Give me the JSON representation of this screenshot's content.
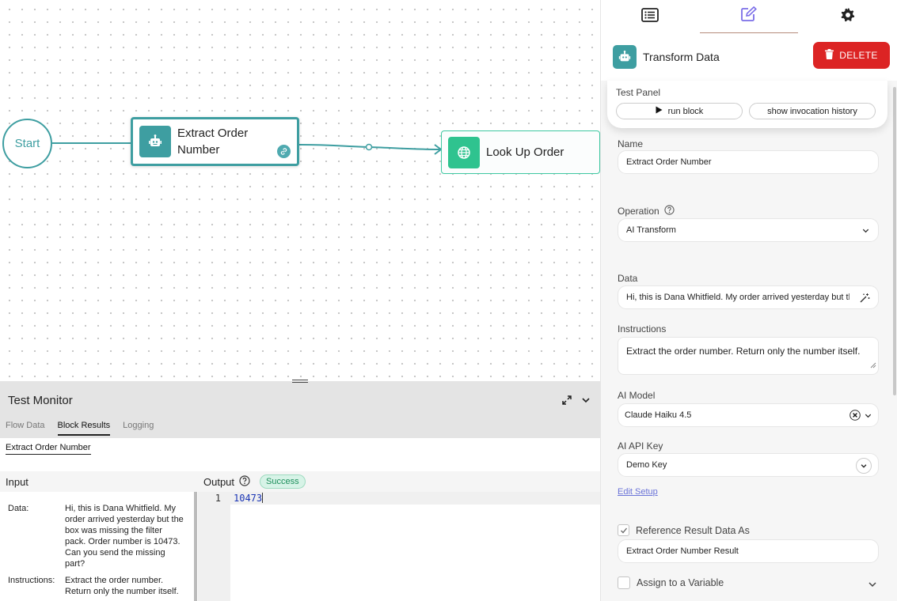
{
  "canvas": {
    "start_label": "Start",
    "nodes": [
      {
        "label": "Extract Order Number",
        "icon": "robot-icon"
      },
      {
        "label": "Look Up Order",
        "icon": "globe-icon"
      }
    ]
  },
  "monitor": {
    "title": "Test Monitor",
    "tabs": [
      "Flow Data",
      "Block Results",
      "Logging"
    ],
    "active_tab": "Block Results",
    "sub_tab": "Extract Order Number",
    "input_header": "Input",
    "output_header": "Output",
    "status": "Success",
    "inputs": [
      {
        "key": "Data:",
        "value": "Hi, this is Dana Whitfield. My order arrived yesterday but the box was missing the filter pack. Order number is 10473. Can you send the missing part?"
      },
      {
        "key": "Instructions:",
        "value": "Extract the order number. Return only the number itself."
      }
    ],
    "output_line_number": "1",
    "output_value": "10473"
  },
  "panel": {
    "title": "Transform Data",
    "delete_label": "DELETE",
    "test_panel": {
      "label": "Test Panel",
      "run_label": "run block",
      "history_label": "show invocation history"
    },
    "name": {
      "label": "Name",
      "value": "Extract Order Number"
    },
    "operation": {
      "label": "Operation",
      "value": "AI Transform"
    },
    "data": {
      "label": "Data",
      "value": "Hi, this is Dana Whitfield. My order arrived yesterday but the box was missing the filter pack."
    },
    "instructions": {
      "label": "Instructions",
      "value": "Extract the order number. Return only the number itself."
    },
    "ai_model": {
      "label": "AI Model",
      "value": "Claude Haiku 4.5"
    },
    "ai_api_key": {
      "label": "AI API Key",
      "value": "Demo Key"
    },
    "edit_setup": "Edit Setup",
    "reference": {
      "label": "Reference Result Data As",
      "value": "Extract Order Number Result",
      "checked": true
    },
    "assign": {
      "label": "Assign to a Variable",
      "checked": false
    }
  },
  "colors": {
    "accent": "#3e9ea1",
    "green_node": "#2fc38f",
    "delete": "#dc2424",
    "success_text": "#1d8e5b",
    "link": "#6a73d8"
  }
}
